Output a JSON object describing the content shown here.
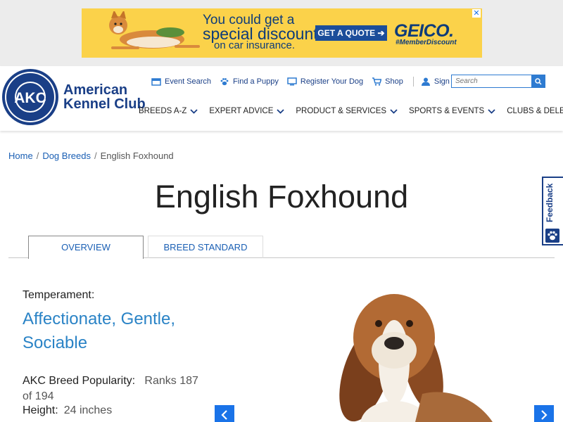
{
  "ad": {
    "line1": "You could get a",
    "line2": "special discount",
    "line3": "on car insurance.",
    "cta": "GET A QUOTE",
    "brand": "GEICO.",
    "tag": "#MemberDiscount",
    "close": "✕"
  },
  "logo": {
    "seal_text": "AKC",
    "line1": "American",
    "line2": "Kennel Club"
  },
  "utility_nav": [
    {
      "label": "Event Search",
      "icon": "calendar-icon"
    },
    {
      "label": "Find a Puppy",
      "icon": "paw-icon"
    },
    {
      "label": "Register Your Dog",
      "icon": "register-icon"
    },
    {
      "label": "Shop",
      "icon": "cart-icon"
    },
    {
      "label": "Sign In",
      "icon": "user-icon"
    }
  ],
  "search": {
    "placeholder": "Search"
  },
  "main_nav": [
    "BREEDS A-Z",
    "EXPERT ADVICE",
    "PRODUCT & SERVICES",
    "SPORTS & EVENTS",
    "CLUBS & DELEGATES"
  ],
  "breadcrumb": {
    "home": "Home",
    "sep": "/",
    "breeds": "Dog Breeds",
    "current": "English Foxhound"
  },
  "page_title": "English Foxhound",
  "tabs": [
    "OVERVIEW",
    "BREED STANDARD"
  ],
  "feedback": "Feedback",
  "breed": {
    "temperament_label": "Temperament:",
    "temperament_value": "Affectionate, Gentle, Sociable",
    "popularity_label": "AKC Breed Popularity:",
    "popularity_value": "Ranks 187 of 194",
    "height_label": "Height:",
    "height_value": "24 inches"
  },
  "colors": {
    "brand_blue": "#1a3f87",
    "link_blue": "#1a5fb4",
    "accent_blue": "#2a83c6",
    "ad_yellow": "#fbd24a"
  }
}
